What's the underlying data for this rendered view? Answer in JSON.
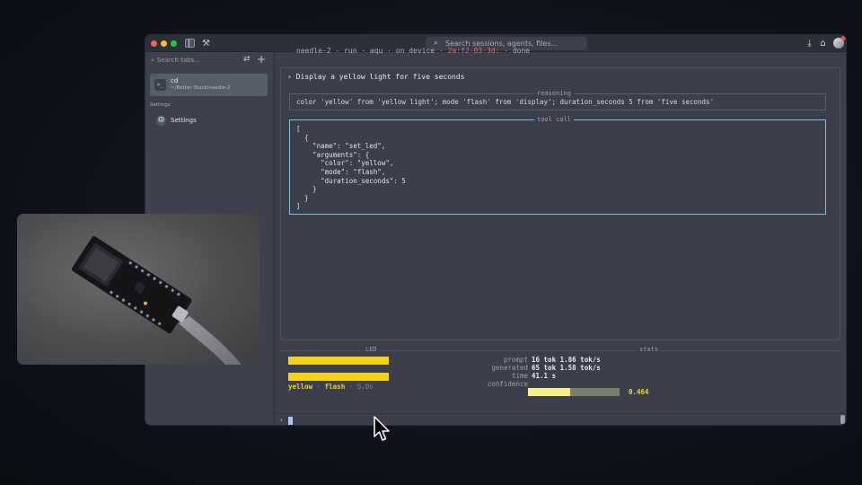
{
  "titlebar": {
    "search_placeholder": "Search sessions, agents, files...",
    "tools_icon": "tools-icon",
    "download_icon": "download-icon",
    "inbox_icon": "inbox-icon"
  },
  "sidebar": {
    "search_placeholder": "Search tabs...",
    "session": {
      "title": "cd",
      "path": "~/Better Stack/needle-2"
    },
    "section_label": "Settings",
    "settings_label": "Settings"
  },
  "main": {
    "clipped_prefix": "needle-2 · run · aqu · on device · ",
    "clipped_highlight": "2a:f2-03-3d:",
    "clipped_suffix": "   · done",
    "prompt": "› Display a yellow light for five seconds",
    "reasoning_label": "reasoning",
    "reasoning_text": "color 'yellow' from 'yellow light'; mode 'flash' from 'display'; duration_seconds 5 from 'five seconds'",
    "toolcall_label": "tool call",
    "toolcall_code": "[\n  {\n    \"name\": \"set_led\",\n    \"arguments\": {\n      \"color\": \"yellow\",\n      \"mode\": \"flash\",\n      \"duration_seconds\": 5\n    }\n  }\n]"
  },
  "led": {
    "label": "LED",
    "color_value": "yellow",
    "separator": "·",
    "mode_value": "flash",
    "duration_value": "5.0s",
    "bar_color": "#f3d21f"
  },
  "stats": {
    "label": "stats",
    "prompt_key": "prompt",
    "prompt_value": "16 tok  1.86 tok/s",
    "generated_key": "generated",
    "generated_value": "65 tok  1.58 tok/s",
    "time_key": "time",
    "time_value": "41.1 s",
    "confidence_key": "confidence",
    "confidence_value": "0.464",
    "confidence_fraction": 0.464
  },
  "input": {
    "caret": "›"
  },
  "colors": {
    "accent_cyan": "#7fc3d8",
    "led_yellow": "#f3d21f",
    "confidence_fill": "#f4ef8c"
  }
}
